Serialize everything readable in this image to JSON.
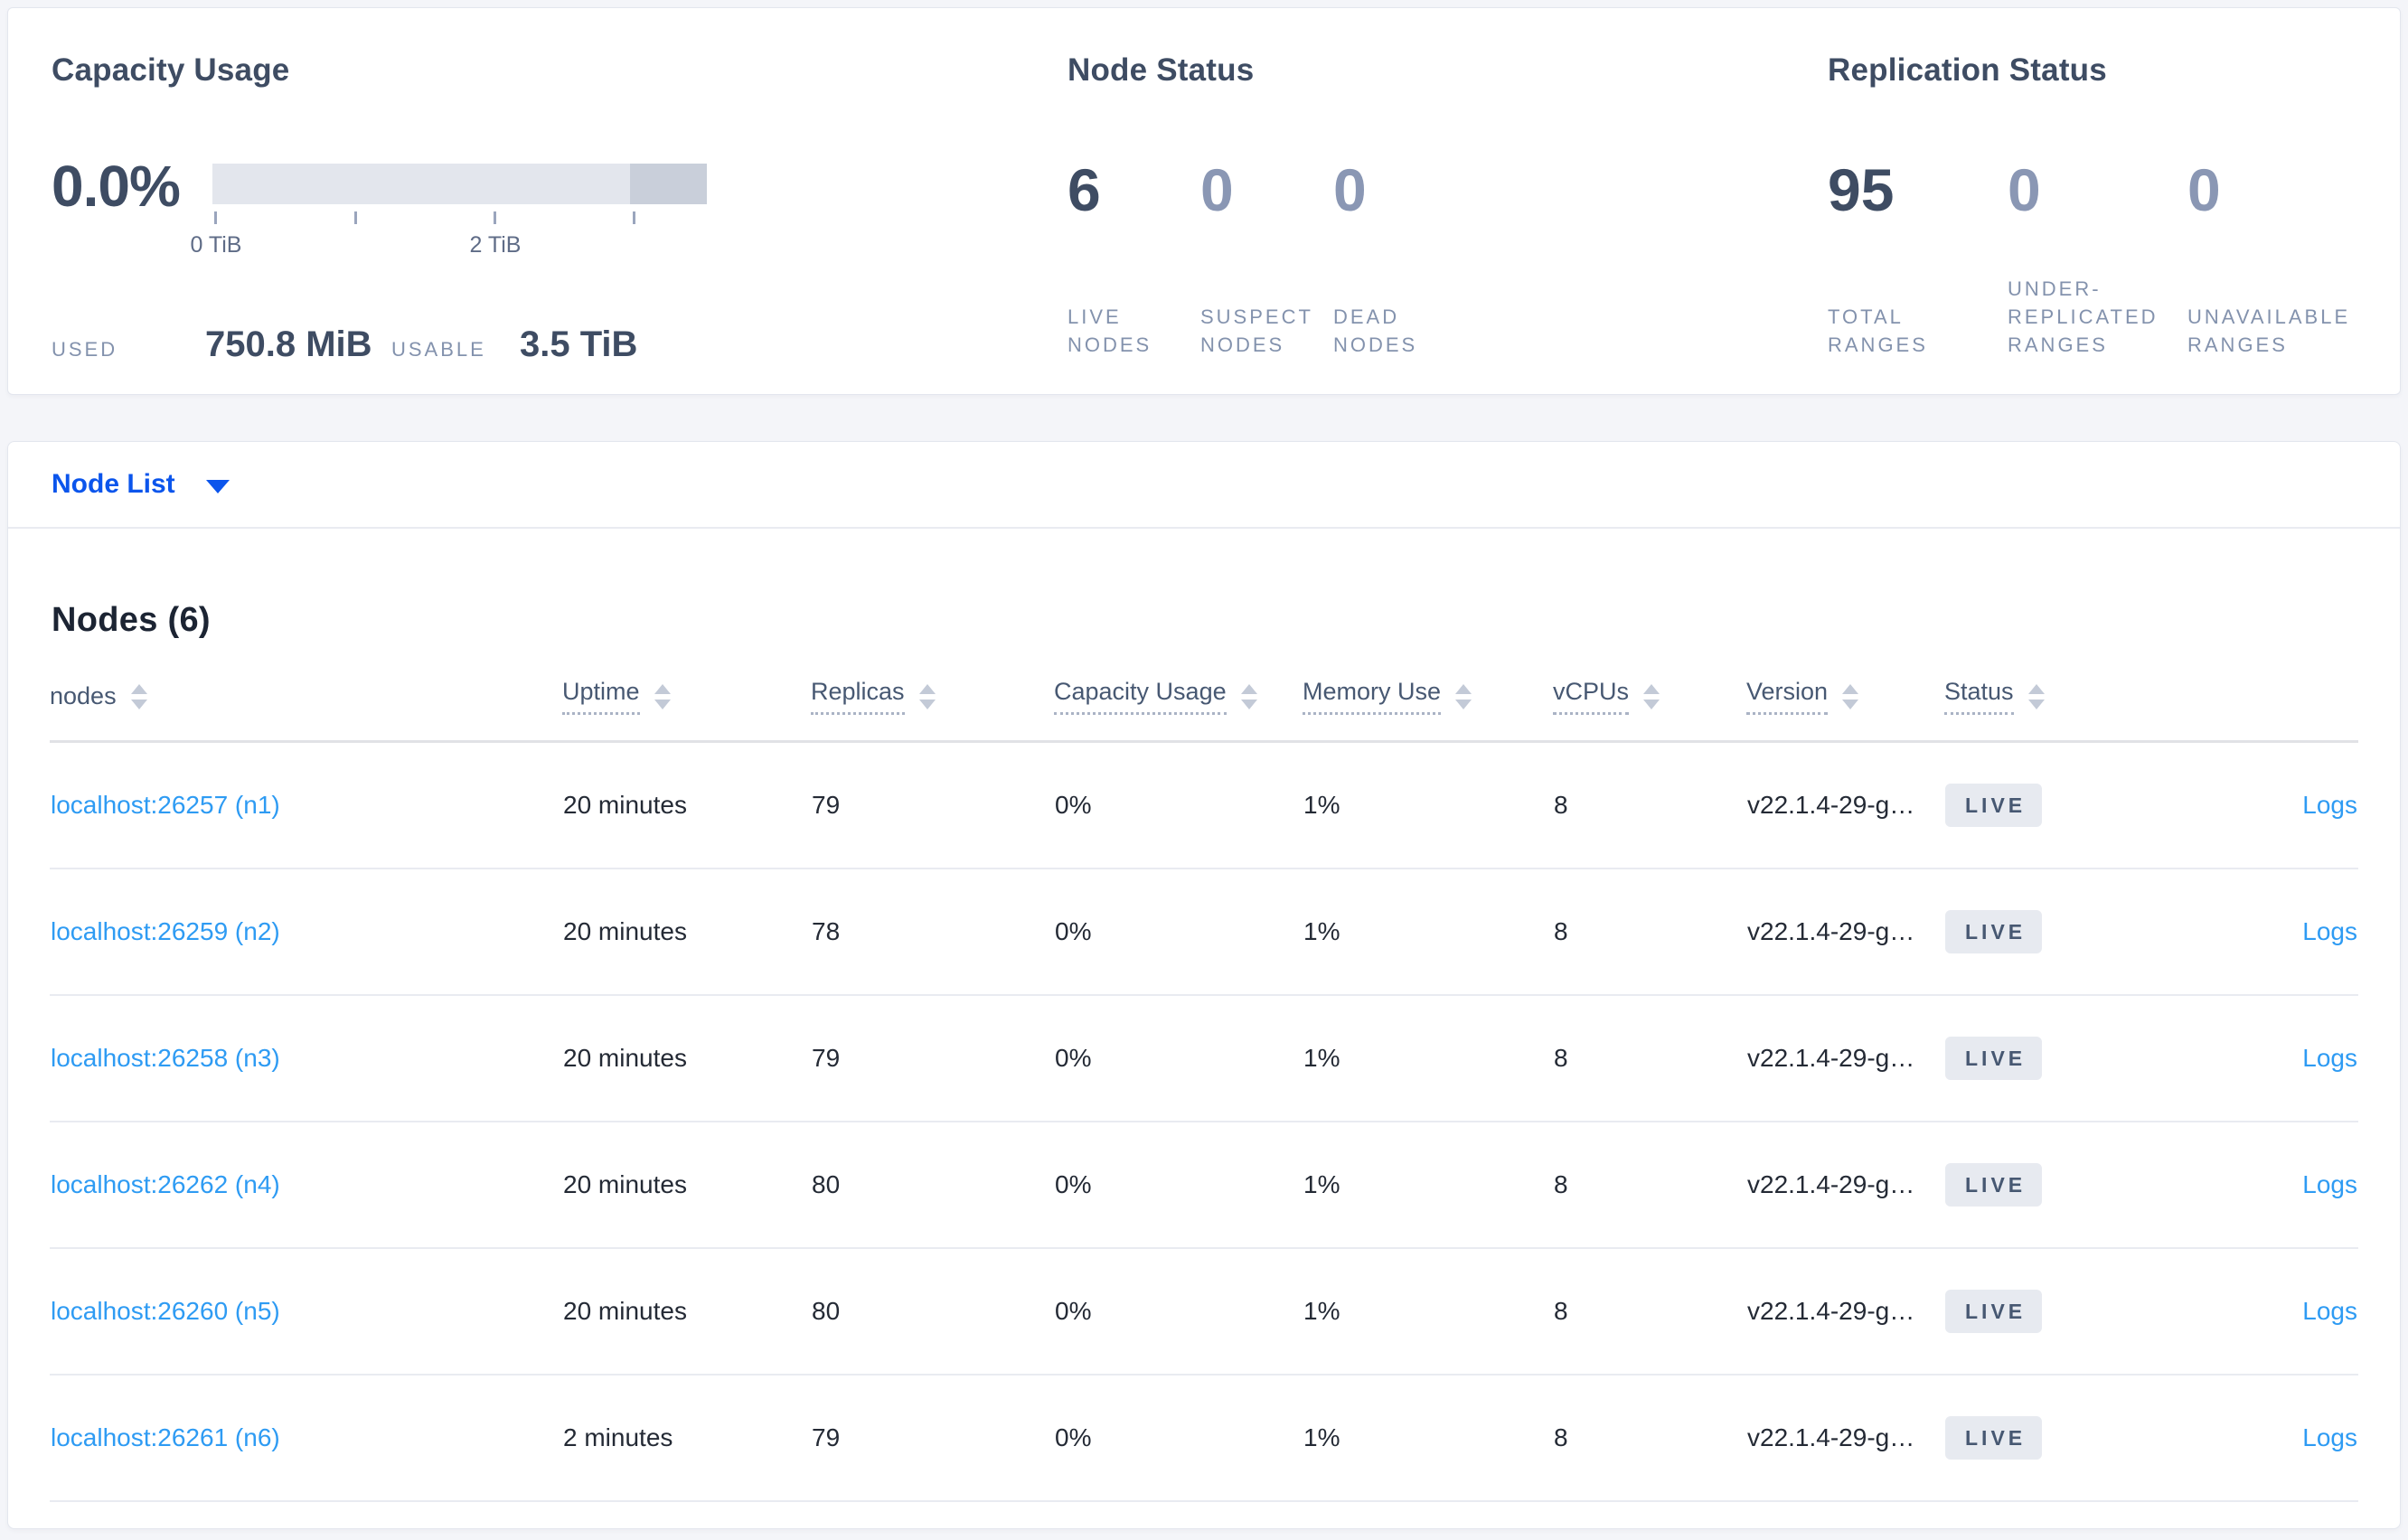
{
  "colors": {
    "accent-blue": "#0b55ec",
    "link-blue": "#2e9bf3",
    "dark-slate": "#3e4c63",
    "muted-slate": "#8a97b4",
    "label-slate": "#8392ad",
    "table-text": "#242a35",
    "header-slate": "#475872",
    "badge-bg": "#e7eaf0",
    "bar-light": "#e3e6ed",
    "bar-dark": "#c9cfda",
    "divider": "#e9ebf1",
    "page-bg": "#f4f5f9"
  },
  "capacity": {
    "title": "Capacity Usage",
    "percent": "0.0%",
    "tick_labels": [
      "0 TiB",
      "2 TiB"
    ],
    "used_label": "USED",
    "used_value": "750.8 MiB",
    "usable_label": "USABLE",
    "usable_value": "3.5 TiB"
  },
  "node_status": {
    "title": "Node Status",
    "stats": [
      {
        "value": "6",
        "label": "LIVE\nNODES"
      },
      {
        "value": "0",
        "label": "SUSPECT\nNODES"
      },
      {
        "value": "0",
        "label": "DEAD\nNODES"
      }
    ]
  },
  "replication_status": {
    "title": "Replication Status",
    "stats": [
      {
        "value": "95",
        "label": "TOTAL\nRANGES"
      },
      {
        "value": "0",
        "label": "UNDER-\nREPLICATED\nRANGES"
      },
      {
        "value": "0",
        "label": "UNAVAILABLE\nRANGES"
      }
    ]
  },
  "view_selector": {
    "label": "Node List"
  },
  "table": {
    "title": "Nodes (6)",
    "logs_label": "Logs",
    "headers": [
      {
        "label": "nodes"
      },
      {
        "label": "Uptime"
      },
      {
        "label": "Replicas"
      },
      {
        "label": "Capacity Usage"
      },
      {
        "label": "Memory Use"
      },
      {
        "label": "vCPUs"
      },
      {
        "label": "Version"
      },
      {
        "label": "Status"
      }
    ],
    "rows": [
      {
        "address": "localhost:26257 (n1)",
        "uptime": "20 minutes",
        "replicas": "79",
        "capacity": "0%",
        "memory": "1%",
        "vcpus": "8",
        "version": "v22.1.4-29-g…",
        "status": "LIVE"
      },
      {
        "address": "localhost:26259 (n2)",
        "uptime": "20 minutes",
        "replicas": "78",
        "capacity": "0%",
        "memory": "1%",
        "vcpus": "8",
        "version": "v22.1.4-29-g…",
        "status": "LIVE"
      },
      {
        "address": "localhost:26258 (n3)",
        "uptime": "20 minutes",
        "replicas": "79",
        "capacity": "0%",
        "memory": "1%",
        "vcpus": "8",
        "version": "v22.1.4-29-g…",
        "status": "LIVE"
      },
      {
        "address": "localhost:26262 (n4)",
        "uptime": "20 minutes",
        "replicas": "80",
        "capacity": "0%",
        "memory": "1%",
        "vcpus": "8",
        "version": "v22.1.4-29-g…",
        "status": "LIVE"
      },
      {
        "address": "localhost:26260 (n5)",
        "uptime": "20 minutes",
        "replicas": "80",
        "capacity": "0%",
        "memory": "1%",
        "vcpus": "8",
        "version": "v22.1.4-29-g…",
        "status": "LIVE"
      },
      {
        "address": "localhost:26261 (n6)",
        "uptime": "2 minutes",
        "replicas": "79",
        "capacity": "0%",
        "memory": "1%",
        "vcpus": "8",
        "version": "v22.1.4-29-g…",
        "status": "LIVE"
      }
    ]
  }
}
